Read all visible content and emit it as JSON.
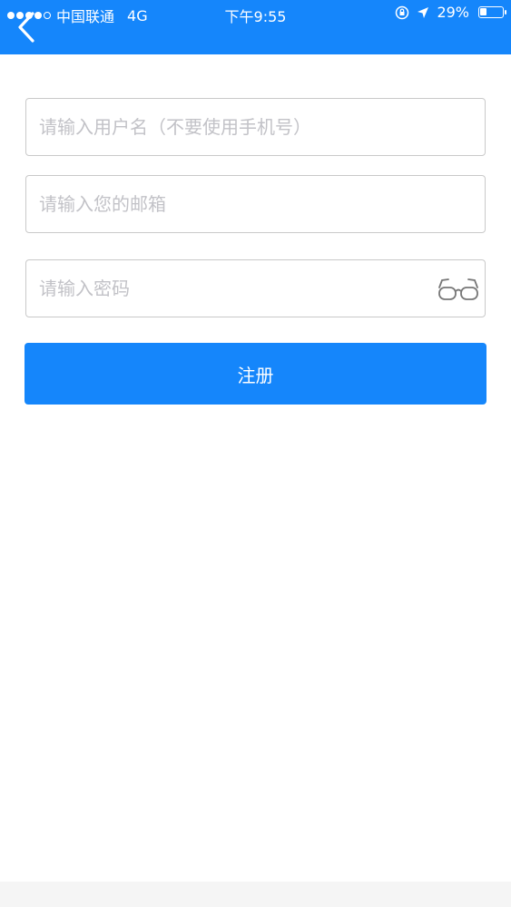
{
  "status_bar": {
    "carrier": "中国联通",
    "network": "4G",
    "time": "下午9:55",
    "battery": "29%",
    "battery_level": 0.29
  },
  "form": {
    "username_placeholder": "请输入用户名（不要使用手机号）",
    "email_placeholder": "请输入您的邮箱",
    "password_placeholder": "请输入密码",
    "submit_label": "注册"
  },
  "colors": {
    "primary": "#1586fb",
    "border": "#c9c9c9",
    "placeholder": "#c2c2c7"
  },
  "icons": {
    "back": "chevron-left-icon",
    "password_toggle": "glasses-icon",
    "lock": "orientation-lock-icon",
    "location": "location-arrow-icon"
  }
}
